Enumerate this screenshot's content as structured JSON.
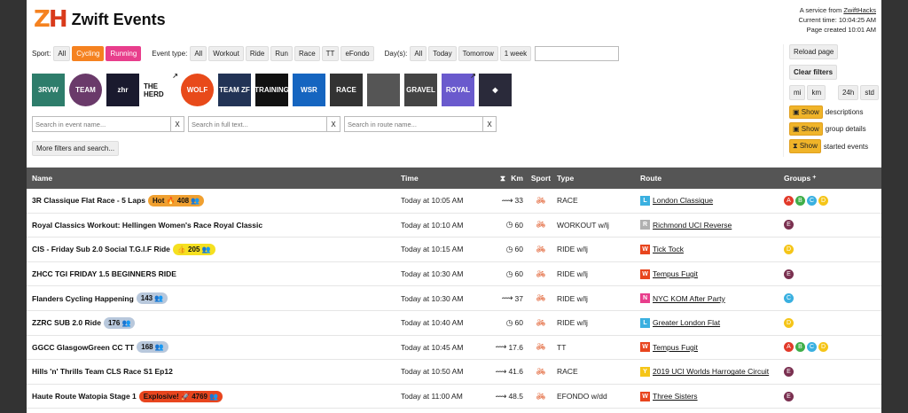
{
  "header": {
    "logo_mark_z": "Z",
    "logo_mark_h": "H",
    "title": "Zwift Events",
    "service_prefix": "A service from",
    "service_link": "ZwiftHacks",
    "current_time": "Current time: 10:04:25 AM",
    "page_created": "Page created 10:01 AM"
  },
  "filters": {
    "sport_label": "Sport:",
    "sport": [
      "All",
      "Cycling",
      "Running"
    ],
    "event_type_label": "Event type:",
    "event_type": [
      "All",
      "Workout",
      "Ride",
      "Run",
      "Race",
      "TT",
      "eFondo"
    ],
    "days_label": "Day(s):",
    "days": [
      "All",
      "Today",
      "Tomorrow",
      "1 week"
    ]
  },
  "logos": [
    {
      "name": "3r-logo",
      "text": "3RVW",
      "bg": "#2e7d6b"
    },
    {
      "name": "team-logo-2",
      "text": "TEAM",
      "bg": "#6a3a6a",
      "round": true
    },
    {
      "name": "zhr-logo",
      "text": "zhr",
      "bg": "#1a1a2e"
    },
    {
      "name": "the-herd-logo",
      "text": "THE HERD",
      "bg": "#ffffff",
      "dark": true,
      "ext": true
    },
    {
      "name": "wolf-logo",
      "text": "WOLF",
      "bg": "#e84a1a",
      "round": true
    },
    {
      "name": "team-zf-logo",
      "text": "TEAM ZF",
      "bg": "#223355"
    },
    {
      "name": "dark-logo",
      "text": "TRAINING",
      "bg": "#111111"
    },
    {
      "name": "wsr-logo",
      "text": "WSR",
      "bg": "#1565c0"
    },
    {
      "name": "race-logo",
      "text": "RACE",
      "bg": "#333333"
    },
    {
      "name": "cyclist-photo-logo",
      "text": "",
      "bg": "#555555"
    },
    {
      "name": "gravel-logo",
      "text": "GRAVEL",
      "bg": "#444444"
    },
    {
      "name": "royal-logo",
      "text": "ROYAL",
      "bg": "#6a5acd",
      "ext": true
    },
    {
      "name": "diamond-logo",
      "text": "◆",
      "bg": "#2a2a3a"
    }
  ],
  "search": {
    "event_placeholder": "Search in event name...",
    "full_placeholder": "Search in full text...",
    "route_placeholder": "Search in route name...",
    "clear": "X",
    "more_label": "More filters and search..."
  },
  "right": {
    "reload": "Reload page",
    "clear": "Clear filters",
    "mi": "mi",
    "km": "km",
    "h24": "24h",
    "std": "std",
    "show_label": "Show",
    "descriptions": "descriptions",
    "group_details": "group details",
    "started_events": "started events"
  },
  "table": {
    "headers": {
      "name": "Name",
      "time": "Time",
      "km": "Km",
      "sport": "Sport",
      "type": "Type",
      "route": "Route",
      "groups": "Groups",
      "groups_plus": "+"
    },
    "rows": [
      {
        "name": "3R Classique Flat Race - 5 Laps",
        "badge": "Hot 🔥 408 👥",
        "badge_class": "b-hot",
        "time": "Today at 10:05 AM",
        "dur_icon": "⟿",
        "dur": "33",
        "type": "RACE",
        "world": "L",
        "world_color": "#3ab0e0",
        "route": "London Classique",
        "groups": [
          "A",
          "B",
          "C",
          "D"
        ]
      },
      {
        "name": "Royal Classics Workout: Hellingen Women's Race Royal Classic",
        "badge": "",
        "badge_class": "",
        "time": "Today at 10:10 AM",
        "dur_icon": "◷",
        "dur": "60",
        "type": "WORKOUT w/lj",
        "world": "R",
        "world_color": "#b0b0b0",
        "route": "Richmond UCI Reverse",
        "groups": [
          "E"
        ]
      },
      {
        "name": "CIS - Friday Sub 2.0 Social T.G.I.F Ride",
        "badge": "👍 205 👥",
        "badge_class": "b-yellow",
        "time": "Today at 10:15 AM",
        "dur_icon": "◷",
        "dur": "60",
        "type": "RIDE w/lj",
        "world": "W",
        "world_color": "#e8451e",
        "route": "Tick Tock",
        "groups": [
          "D"
        ]
      },
      {
        "name": "ZHCC TGI FRIDAY 1.5 BEGINNERS RIDE",
        "badge": "",
        "badge_class": "",
        "time": "Today at 10:30 AM",
        "dur_icon": "◷",
        "dur": "60",
        "type": "RIDE w/lj",
        "world": "W",
        "world_color": "#e8451e",
        "route": "Tempus Fugit",
        "groups": [
          "E"
        ]
      },
      {
        "name": "Flanders Cycling Happening",
        "badge": "143 👥",
        "badge_class": "b-grey",
        "time": "Today at 10:30 AM",
        "dur_icon": "⟿",
        "dur": "37",
        "type": "RIDE w/lj",
        "world": "N",
        "world_color": "#e83e8c",
        "route": "NYC KOM After Party",
        "groups": [
          "C"
        ]
      },
      {
        "name": "ZZRC SUB 2.0 Ride",
        "badge": "176 👥",
        "badge_class": "b-grey",
        "time": "Today at 10:40 AM",
        "dur_icon": "◷",
        "dur": "60",
        "type": "RIDE w/lj",
        "world": "L",
        "world_color": "#3ab0e0",
        "route": "Greater London Flat",
        "groups": [
          "D"
        ]
      },
      {
        "name": "GGCC GlasgowGreen CC TT",
        "badge": "168 👥",
        "badge_class": "b-grey",
        "time": "Today at 10:45 AM",
        "dur_icon": "⟿",
        "dur": "17.6",
        "type": "TT",
        "world": "W",
        "world_color": "#e8451e",
        "route": "Tempus Fugit",
        "groups": [
          "A",
          "B",
          "C",
          "D"
        ]
      },
      {
        "name": "Hills 'n' Thrills Team CLS Race S1 Ep12",
        "badge": "",
        "badge_class": "",
        "time": "Today at 10:50 AM",
        "dur_icon": "⟿",
        "dur": "41.6",
        "type": "RACE",
        "world": "Y",
        "world_color": "#f5c518",
        "route": "2019 UCI Worlds Harrogate Circuit",
        "groups": [
          "E"
        ]
      },
      {
        "name": "Haute Route Watopia Stage 1",
        "badge": "Explosive! 🚀 4769 👥",
        "badge_class": "b-red",
        "time": "Today at 11:00 AM",
        "dur_icon": "⟿",
        "dur": "48.5",
        "type": "EFONDO w/dd",
        "world": "W",
        "world_color": "#e8451e",
        "route": "Three Sisters",
        "groups": [
          "E"
        ]
      }
    ]
  }
}
